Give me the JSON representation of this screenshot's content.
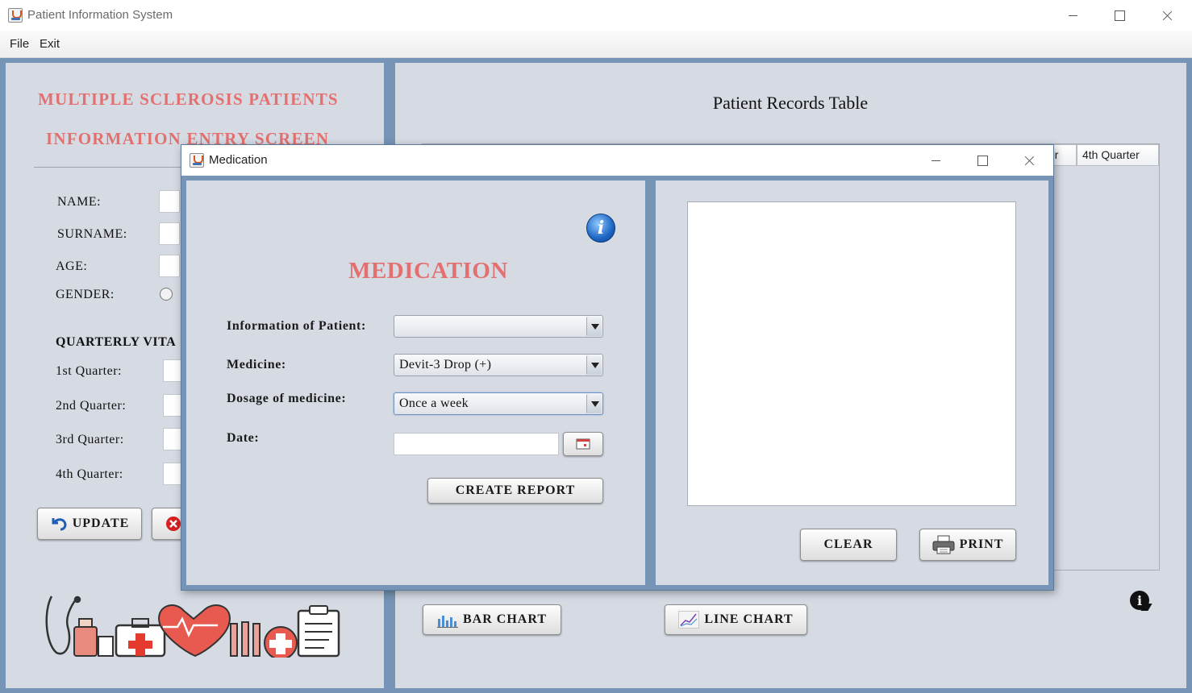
{
  "window": {
    "title": "Patient Information System",
    "controls": [
      "minimize",
      "maximize",
      "close"
    ]
  },
  "menu": {
    "items": [
      "File",
      "Exit"
    ]
  },
  "left_panel": {
    "title_line1": "MULTIPLE SCLEROSIS PATIENTS",
    "title_line2": "INFORMATION ENTRY SCREEN",
    "labels": {
      "name": "NAME:",
      "surname": "SURNAME:",
      "age": "AGE:",
      "gender": "GENDER:",
      "quarterly": "QUARTERLY VITA",
      "q1": "1st Quarter:",
      "q2": "2nd Quarter:",
      "q3": "3rd Quarter:",
      "q4": "4th Quarter:"
    },
    "update_button": "UPDATE"
  },
  "right_panel": {
    "title": "Patient Records Table",
    "table_headers": [
      "er",
      "4th Quarter"
    ],
    "bar_chart_button": "BAR CHART",
    "line_chart_button": "LINE CHART"
  },
  "dialog": {
    "title": "Medication",
    "heading": "MEDICATION",
    "labels": {
      "patient_info": "Information of Patient:",
      "medicine": "Medicine:",
      "dosage": "Dosage of medicine:",
      "date": "Date:"
    },
    "values": {
      "patient_info": "",
      "medicine": "Devit-3 Drop (+)",
      "dosage": "Once a week",
      "date": ""
    },
    "create_report_button": "CREATE REPORT",
    "clear_button": "CLEAR",
    "print_button": "PRINT"
  },
  "colors": {
    "accent_title": "#e3706f",
    "panel_bg": "#d6dae3",
    "frame_bg": "#7694b5"
  }
}
